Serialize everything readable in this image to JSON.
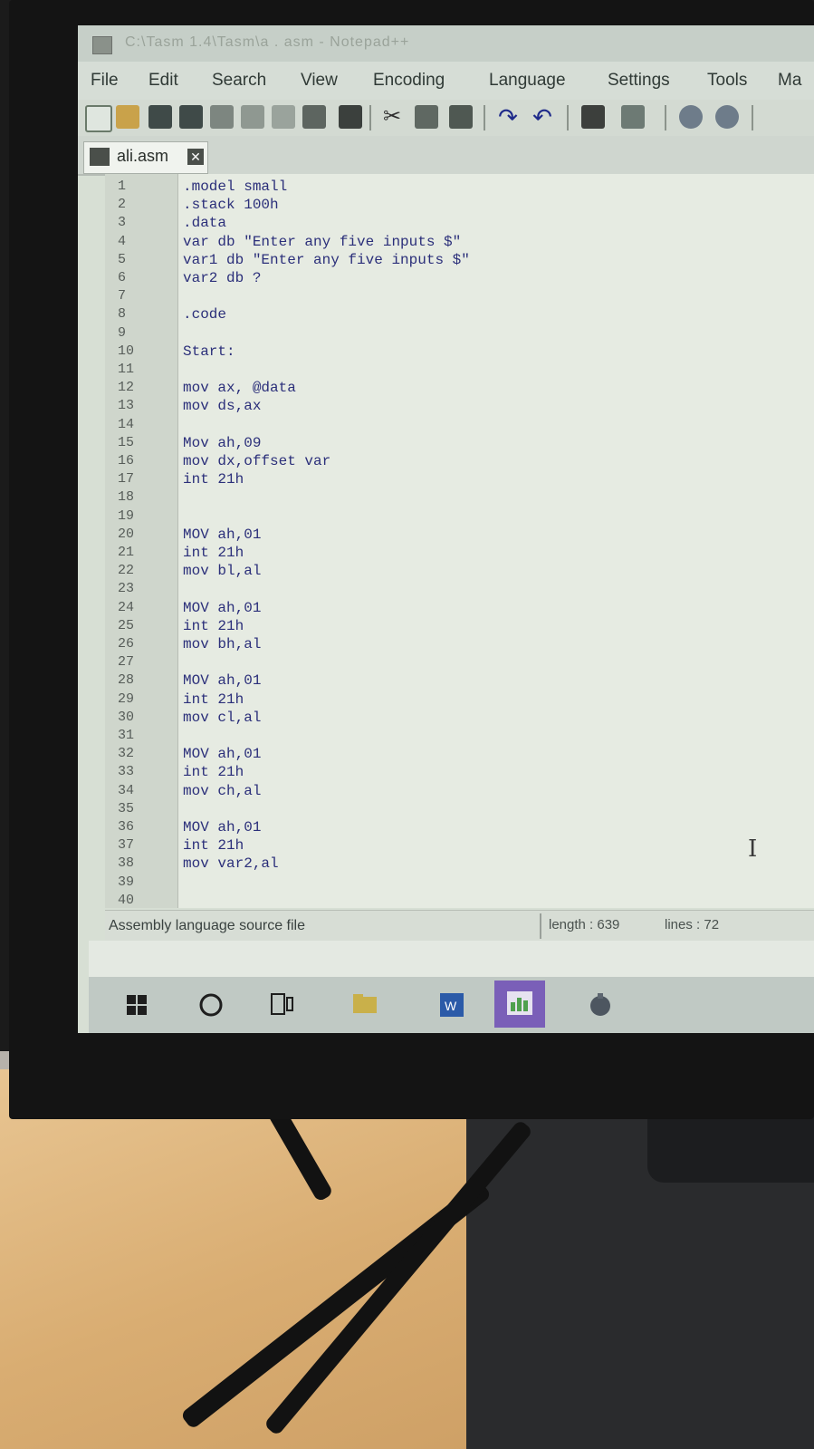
{
  "window": {
    "title": "C:\\Tasm 1.4\\Tasm\\a . asm - Notepad++"
  },
  "menu": [
    "File",
    "Edit",
    "Search",
    "View",
    "Encoding",
    "Language",
    "Settings",
    "Tools",
    "Ma"
  ],
  "toolbar_icons": [
    "new-file-icon",
    "open-file-icon",
    "save-icon",
    "save-all-icon",
    "close-icon",
    "close-all-icon",
    "print-icon",
    "cut-icon",
    "copy-icon",
    "paste-icon",
    "undo-icon",
    "redo-icon",
    "find-icon",
    "replace-icon",
    "zoom-in-icon",
    "zoom-out-icon"
  ],
  "tab": {
    "label": "ali.asm",
    "close": "✕"
  },
  "lines": [
    {
      "n": "1",
      "code": ".model small"
    },
    {
      "n": "2",
      "code": ".stack 100h"
    },
    {
      "n": "3",
      "code": ".data"
    },
    {
      "n": "4",
      "code": "var db \"Enter any five inputs $\""
    },
    {
      "n": "5",
      "code": "var1 db \"Enter any five inputs $\""
    },
    {
      "n": "6",
      "code": "var2 db ?"
    },
    {
      "n": "7",
      "code": ""
    },
    {
      "n": "8",
      "code": ".code"
    },
    {
      "n": "9",
      "code": ""
    },
    {
      "n": "10",
      "code": "Start:"
    },
    {
      "n": "11",
      "code": ""
    },
    {
      "n": "12",
      "code": "mov ax, @data"
    },
    {
      "n": "13",
      "code": "mov ds,ax"
    },
    {
      "n": "14",
      "code": ""
    },
    {
      "n": "15",
      "code": "Mov ah,09"
    },
    {
      "n": "16",
      "code": "mov dx,offset var"
    },
    {
      "n": "17",
      "code": "int 21h"
    },
    {
      "n": "18",
      "code": ""
    },
    {
      "n": "19",
      "code": ""
    },
    {
      "n": "20",
      "code": "MOV ah,01"
    },
    {
      "n": "21",
      "code": "int 21h"
    },
    {
      "n": "22",
      "code": "mov bl,al"
    },
    {
      "n": "23",
      "code": ""
    },
    {
      "n": "24",
      "code": "MOV ah,01"
    },
    {
      "n": "25",
      "code": "int 21h"
    },
    {
      "n": "26",
      "code": "mov bh,al"
    },
    {
      "n": "27",
      "code": ""
    },
    {
      "n": "28",
      "code": "MOV ah,01"
    },
    {
      "n": "29",
      "code": "int 21h"
    },
    {
      "n": "30",
      "code": "mov cl,al"
    },
    {
      "n": "31",
      "code": ""
    },
    {
      "n": "32",
      "code": "MOV ah,01"
    },
    {
      "n": "33",
      "code": "int 21h"
    },
    {
      "n": "34",
      "code": "mov ch,al"
    },
    {
      "n": "35",
      "code": ""
    },
    {
      "n": "36",
      "code": "MOV ah,01"
    },
    {
      "n": "37",
      "code": "int 21h"
    },
    {
      "n": "38",
      "code": "mov var2,al"
    },
    {
      "n": "39",
      "code": ""
    },
    {
      "n": "40",
      "code": ""
    }
  ],
  "status": {
    "file_type": "Assembly language source file",
    "length": "length : 639",
    "lines": "lines : 72"
  },
  "taskbar": [
    "start-button",
    "cortana-button",
    "task-view-button",
    "file-explorer-button",
    "word-button",
    "powerpoint-button",
    "app-button"
  ],
  "colors": {
    "code_text": "#2b2f7a",
    "editor_bg": "#e6ebe2"
  }
}
